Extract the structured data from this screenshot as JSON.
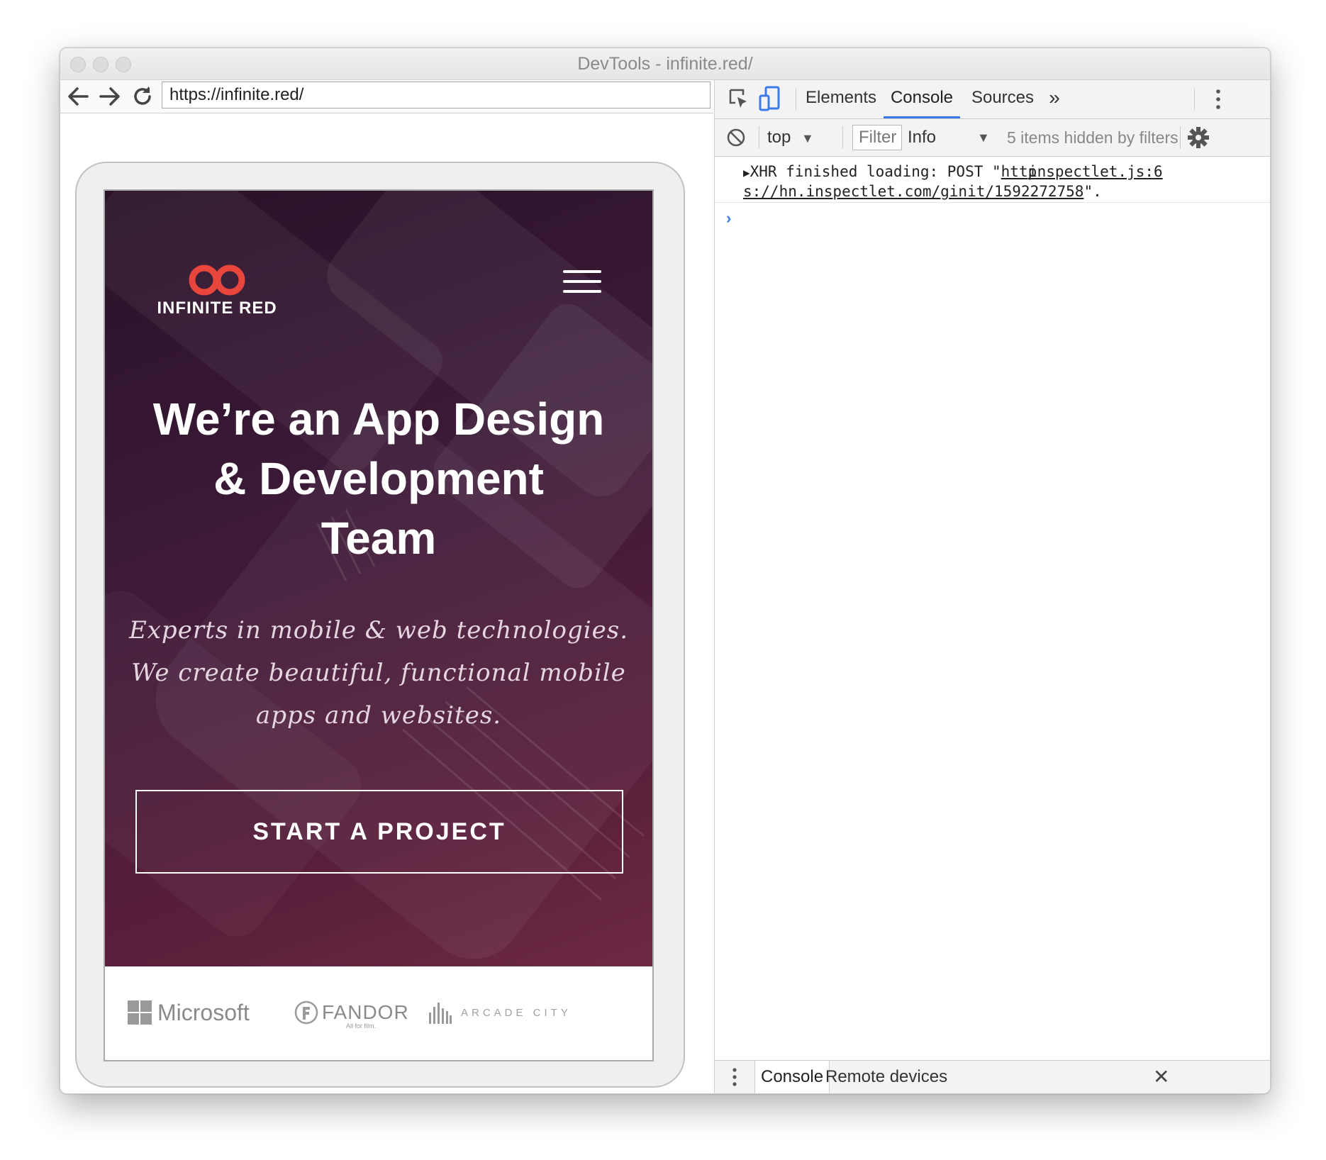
{
  "window": {
    "title": "DevTools - infinite.red/"
  },
  "browser": {
    "url": "https://infinite.red/",
    "back_icon": "arrow-left",
    "forward_icon": "arrow-right",
    "reload_icon": "reload"
  },
  "site": {
    "logo_text": "INFINITE RED",
    "headline_lines": [
      "We’re an App Design",
      "& Development",
      "Team"
    ],
    "subtext_lines": [
      "Experts in mobile & web technologies.",
      "We create beautiful, functional mobile",
      "apps and websites."
    ],
    "cta_label": "START A PROJECT",
    "clients": {
      "microsoft": "Microsoft",
      "fandor": "FANDOR",
      "fandor_tagline": "All for film.",
      "arcade": "ARCADE CITY"
    },
    "accent_color": "#e8453c"
  },
  "devtools": {
    "tabs": [
      "Elements",
      "Console",
      "Sources"
    ],
    "active_tab": "Console",
    "more_tabs": "»",
    "toolbar": {
      "context": "top",
      "filter_placeholder": "Filter",
      "level": "Info",
      "hidden_text": "5 items hidden by filters"
    },
    "messages": [
      {
        "prefix": "XHR finished loading: POST \"",
        "url_part1": "http",
        "url_part2": "s://hn.inspectlet.com/ginit/1592272758",
        "suffix": "\".",
        "source": "inspectlet.js:6"
      }
    ],
    "prompt": "›",
    "drawer": {
      "tabs": [
        "Console",
        "Remote devices"
      ],
      "active": "Console",
      "close": "✕"
    }
  }
}
